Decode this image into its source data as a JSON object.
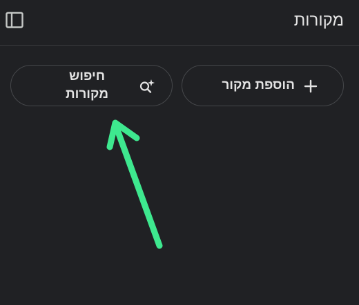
{
  "header": {
    "title": "מקורות",
    "collapse_icon": "sidebar-panel-icon"
  },
  "actions": {
    "add_source_label": "הוספת מקור",
    "add_source_icon": "plus-icon",
    "search_sources_label": "חיפוש מקורות",
    "search_sources_icon": "sparkle-search-icon"
  },
  "annotation": {
    "arrow_color": "#3ee88f",
    "arrow_icon": "annotation-arrow"
  },
  "colors": {
    "background": "#202124",
    "text": "#e3e3e3",
    "border": "#45474a"
  }
}
